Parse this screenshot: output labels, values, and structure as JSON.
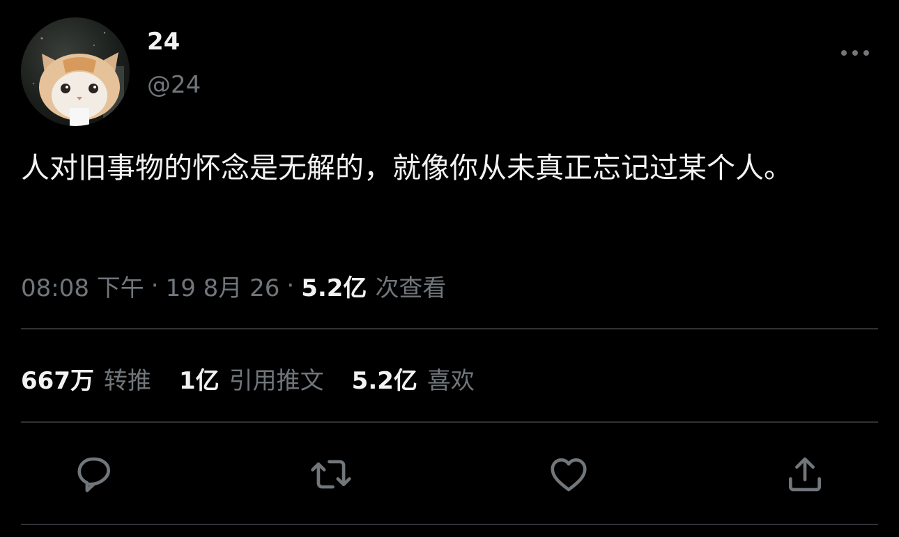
{
  "user": {
    "display_name": "24",
    "handle": "@24",
    "avatar_icon": "cat-avatar"
  },
  "header": {
    "more_icon": "more-horizontal-icon"
  },
  "tweet": {
    "text": "人对旧事物的怀念是无解的，就像你从未真正忘记过某个人。"
  },
  "meta": {
    "time": "08:08 下午",
    "separator": "·",
    "date": "19 8月 26",
    "views_count": "5.2亿",
    "views_label": "次查看"
  },
  "stats": [
    {
      "count": "667万",
      "label": "转推"
    },
    {
      "count": "1亿",
      "label": "引用推文"
    },
    {
      "count": "5.2亿",
      "label": "喜欢"
    }
  ],
  "actions": {
    "reply_icon": "reply-icon",
    "retweet_icon": "retweet-icon",
    "like_icon": "like-icon",
    "share_icon": "share-icon"
  },
  "colors": {
    "background": "#000000",
    "text_primary": "#f2f2f2",
    "text_secondary": "#71767b",
    "divider": "#2f3336"
  }
}
